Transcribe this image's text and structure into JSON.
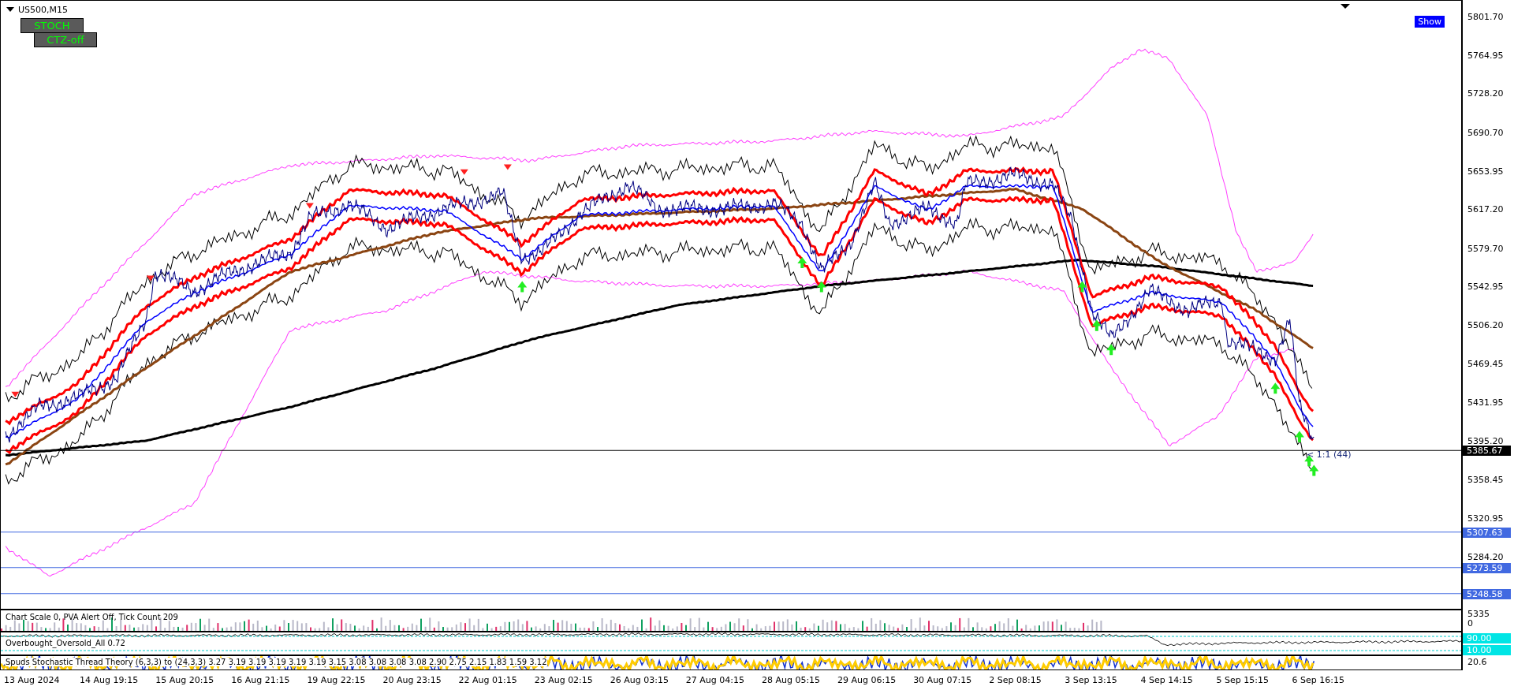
{
  "symbol": {
    "title": "US500,M15"
  },
  "indicator_buttons": [
    {
      "label": "STOCH"
    },
    {
      "label": "CTZ-off"
    }
  ],
  "show_button": {
    "label": "Show"
  },
  "price_axis": [
    "5801.70",
    "5764.95",
    "5728.20",
    "5690.70",
    "5653.95",
    "5617.20",
    "5579.70",
    "5542.95",
    "5506.20",
    "5469.45",
    "5431.95",
    "5395.20",
    "5358.45",
    "5320.95",
    "5284.20"
  ],
  "price_tags": [
    {
      "label": "5385.67",
      "kind": "bid"
    },
    {
      "label": "5307.63",
      "kind": "level"
    },
    {
      "label": "5273.59",
      "kind": "level"
    },
    {
      "label": "5248.58",
      "kind": "level"
    }
  ],
  "ratio_label": "< 1:1 (44)",
  "volume_panel": {
    "info": "Chart Scale 0,  PVA Alert Off,  Tick Count 209",
    "axis": [
      "5335",
      "0"
    ]
  },
  "oscillator_panel": {
    "label": "Overbought_Oversold_All 0.72",
    "tags": [
      "90.00",
      "10.00"
    ]
  },
  "stochastic_panel": {
    "label": "Spuds Stochastic Thread Theory (6,3,3) to (24,3,3) 3.27 3.19 3.19 3.19 3.19 3.19 3.15 3.08 3.08 3.08 3.08 2.90 2.75 2.15 1.83 1.59 3.12",
    "axis": [
      "20.6"
    ]
  },
  "time_axis": [
    "13 Aug 2024",
    "14 Aug 19:15",
    "15 Aug 20:15",
    "16 Aug 21:15",
    "19 Aug 22:15",
    "20 Aug 23:15",
    "22 Aug 01:15",
    "23 Aug 02:15",
    "26 Aug 03:15",
    "27 Aug 04:15",
    "28 Aug 05:15",
    "29 Aug 06:15",
    "30 Aug 07:15",
    "2 Sep 08:15",
    "3 Sep 13:15",
    "4 Sep 14:15",
    "5 Sep 15:15",
    "6 Sep 16:15"
  ]
}
